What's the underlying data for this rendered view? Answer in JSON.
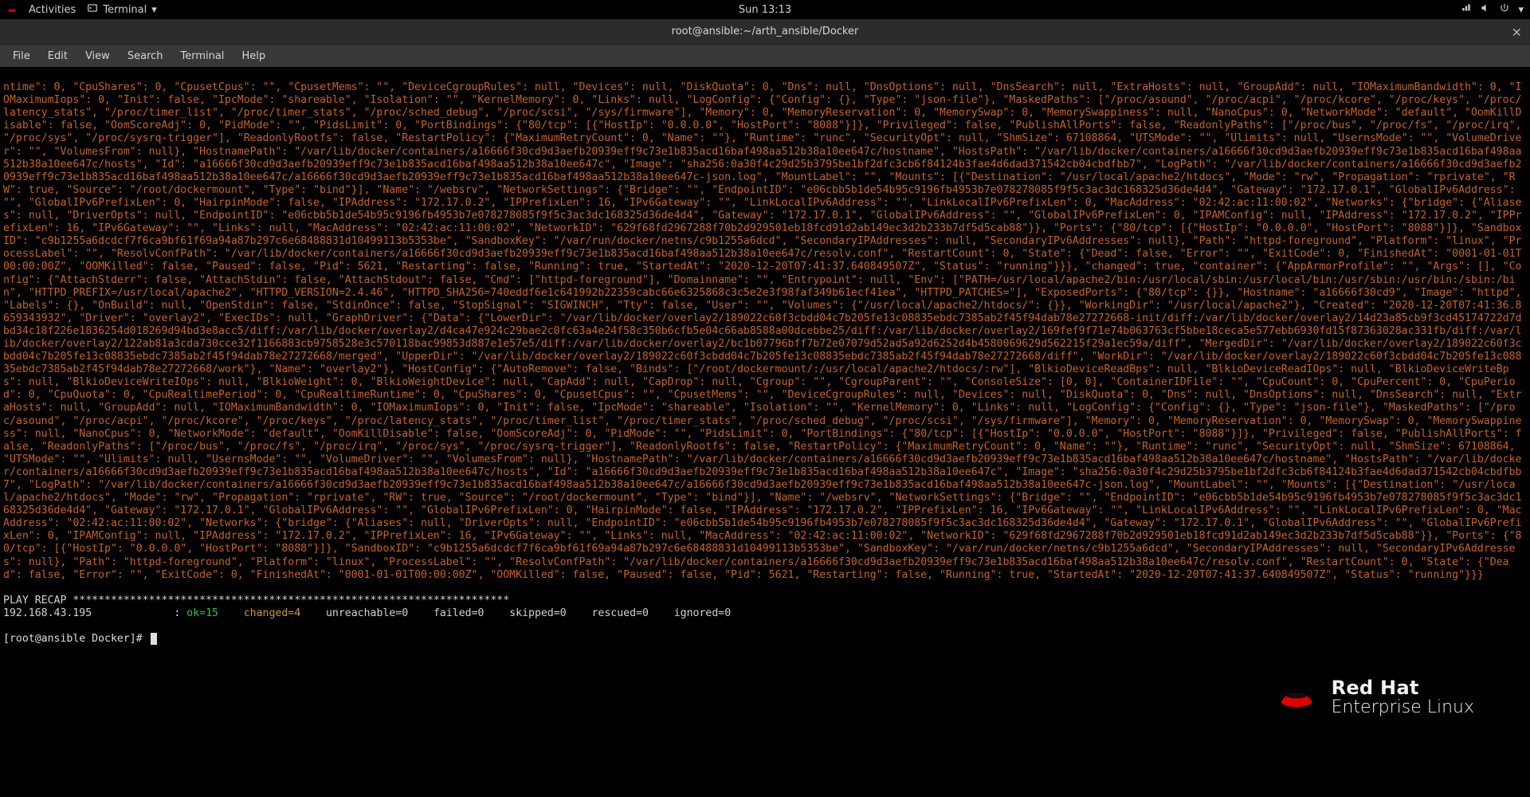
{
  "topbar": {
    "activities": "Activities",
    "app": "Terminal",
    "clock": "Sun 13:13"
  },
  "window": {
    "title": "root@ansible:~/arth_ansible/Docker"
  },
  "menu": {
    "items": [
      "File",
      "Edit",
      "View",
      "Search",
      "Terminal",
      "Help"
    ]
  },
  "docker_json": "ntime\": 0, \"CpuShares\": 0, \"CpusetCpus\": \"\", \"CpusetMems\": \"\", \"DeviceCgroupRules\": null, \"Devices\": null, \"DiskQuota\": 0, \"Dns\": null, \"DnsOptions\": null, \"DnsSearch\": null, \"ExtraHosts\": null, \"GroupAdd\": null, \"IOMaximumBandwidth\": 0, \"IOMaximumIops\": 0, \"Init\": false, \"IpcMode\": \"shareable\", \"Isolation\": \"\", \"KernelMemory\": 0, \"Links\": null, \"LogConfig\": {\"Config\": {}, \"Type\": \"json-file\"}, \"MaskedPaths\": [\"/proc/asound\", \"/proc/acpi\", \"/proc/kcore\", \"/proc/keys\", \"/proc/latency_stats\", \"/proc/timer_list\", \"/proc/timer_stats\", \"/proc/sched_debug\", \"/proc/scsi\", \"/sys/firmware\"], \"Memory\": 0, \"MemoryReservation\": 0, \"MemorySwap\": 0, \"MemorySwappiness\": null, \"NanoCpus\": 0, \"NetworkMode\": \"default\", \"OomKillDisable\": false, \"OomScoreAdj\": 0, \"PidMode\": \"\", \"PidsLimit\": 0, \"PortBindings\": {\"80/tcp\": [{\"HostIp\": \"0.0.0.0\", \"HostPort\": \"8088\"}]}, \"Privileged\": false, \"PublishAllPorts\": false, \"ReadonlyPaths\": [\"/proc/bus\", \"/proc/fs\", \"/proc/irq\", \"/proc/sys\", \"/proc/sysrq-trigger\"], \"ReadonlyRootfs\": false, \"RestartPolicy\": {\"MaximumRetryCount\": 0, \"Name\": \"\"}, \"Runtime\": \"runc\", \"SecurityOpt\": null, \"ShmSize\": 67108864, \"UTSMode\": \"\", \"Ulimits\": null, \"UsernsMode\": \"\", \"VolumeDriver\": \"\", \"VolumesFrom\": null}, \"HostnamePath\": \"/var/lib/docker/containers/a16666f30cd9d3aefb20939eff9c73e1b835acd16baf498aa512b38a10ee647c/hostname\", \"HostsPath\": \"/var/lib/docker/containers/a16666f30cd9d3aefb20939eff9c73e1b835acd16baf498aa512b38a10ee647c/hosts\", \"Id\": \"a16666f30cd9d3aefb20939eff9c73e1b835acd16baf498aa512b38a10ee647c\", \"Image\": \"sha256:0a30f4c29d25b3795be1bf2dfc3cb6f84124b3fae4d6dad371542cb04cbdfbb7\", \"LogPath\": \"/var/lib/docker/containers/a16666f30cd9d3aefb20939eff9c73e1b835acd16baf498aa512b38a10ee647c/a16666f30cd9d3aefb20939eff9c73e1b835acd16baf498aa512b38a10ee647c-json.log\", \"MountLabel\": \"\", \"Mounts\": [{\"Destination\": \"/usr/local/apache2/htdocs\", \"Mode\": \"rw\", \"Propagation\": \"rprivate\", \"RW\": true, \"Source\": \"/root/dockermount\", \"Type\": \"bind\"}], \"Name\": \"/websrv\", \"NetworkSettings\": {\"Bridge\": \"\", \"EndpointID\": \"e06cbb5b1de54b95c9196fb4953b7e078278085f9f5c3ac3dc168325d36de4d4\", \"Gateway\": \"172.17.0.1\", \"GlobalIPv6Address\": \"\", \"GlobalIPv6PrefixLen\": 0, \"HairpinMode\": false, \"IPAddress\": \"172.17.0.2\", \"IPPrefixLen\": 16, \"IPv6Gateway\": \"\", \"LinkLocalIPv6Address\": \"\", \"LinkLocalIPv6PrefixLen\": 0, \"MacAddress\": \"02:42:ac:11:00:02\", \"Networks\": {\"bridge\": {\"Aliases\": null, \"DriverOpts\": null, \"EndpointID\": \"e06cbb5b1de54b95c9196fb4953b7e078278085f9f5c3ac3dc168325d36de4d4\", \"Gateway\": \"172.17.0.1\", \"GlobalIPv6Address\": \"\", \"GlobalIPv6PrefixLen\": 0, \"IPAMConfig\": null, \"IPAddress\": \"172.17.0.2\", \"IPPrefixLen\": 16, \"IPv6Gateway\": \"\", \"Links\": null, \"MacAddress\": \"02:42:ac:11:00:02\", \"NetworkID\": \"629f68fd2967288f70b2d929501eb18fcd91d2ab149ec3d2b233b7df5d5cab88\"}}, \"Ports\": {\"80/tcp\": [{\"HostIp\": \"0.0.0.0\", \"HostPort\": \"8088\"}]}, \"SandboxID\": \"c9b1255a6dcdcf7f6ca9bf61f69a94a87b297c6e68488831d10499113b5353be\", \"SandboxKey\": \"/var/run/docker/netns/c9b1255a6dcd\", \"SecondaryIPAddresses\": null, \"SecondaryIPv6Addresses\": null}, \"Path\": \"httpd-foreground\", \"Platform\": \"linux\", \"ProcessLabel\": \"\", \"ResolvConfPath\": \"/var/lib/docker/containers/a16666f30cd9d3aefb20939eff9c73e1b835acd16baf498aa512b38a10ee647c/resolv.conf\", \"RestartCount\": 0, \"State\": {\"Dead\": false, \"Error\": \"\", \"ExitCode\": 0, \"FinishedAt\": \"0001-01-01T00:00:00Z\", \"OOMKilled\": false, \"Paused\": false, \"Pid\": 5621, \"Restarting\": false, \"Running\": true, \"StartedAt\": \"2020-12-20T07:41:37.640849507Z\", \"Status\": \"running\"}}}, \"changed\": true, \"container\": {\"AppArmorProfile\": \"\", \"Args\": [], \"Config\": {\"AttachStderr\": false, \"AttachStdin\": false, \"AttachStdout\": false, \"Cmd\": [\"httpd-foreground\"], \"Domainname\": \"\", \"Entrypoint\": null, \"Env\": [\"PATH=/usr/local/apache2/bin:/usr/local/sbin:/usr/local/bin:/usr/sbin:/usr/bin:/sbin:/bin\", \"HTTPD_PREFIX=/usr/local/apache2\", \"HTTPD_VERSION=2.4.46\", \"HTTPD_SHA256=740eddf6e1c641992b22359cabc66e6325868c3c5e2e3f98faf349b61ecf41ea\", \"HTTPD_PATCHES=\"], \"ExposedPorts\": {\"80/tcp\": {}}, \"Hostname\": \"a16666f30cd9\", \"Image\": \"httpd\", \"Labels\": {}, \"OnBuild\": null, \"OpenStdin\": false, \"StdinOnce\": false, \"StopSignal\": \"SIGWINCH\", \"Tty\": false, \"User\": \"\", \"Volumes\": {\"/usr/local/apache2/htdocs/\": {}}, \"WorkingDir\": \"/usr/local/apache2\"}, \"Created\": \"2020-12-20T07:41:36.8659343932\", \"Driver\": \"overlay2\", \"ExecIDs\": null, \"GraphDriver\": {\"Data\": {\"LowerDir\": \"/var/lib/docker/overlay2/189022c60f3cbdd04c7b205fe13c08835ebdc7385ab2f45f94dab78e27272668-init/diff:/var/lib/docker/overlay2/14d23a85cb9f3cd45174722d7dbd34c18f226e1836254d018269d94bd3e8acc5/diff:/var/lib/docker/overlay2/d4ca47e924c29bae2c0fc63a4e24f58c350b6cfb5e04c66ab8588a00dcebbe25/diff:/var/lib/docker/overlay2/169fef9f71e74b063763cf5bbe18ceca5e577ebb6930fd15f87363028ac331fb/diff:/var/lib/docker/overlay2/122ab81a3cda730cce32f1166883cb9758528e3c570118bac99853d887e1e57e5/diff:/var/lib/docker/overlay2/bc1b07796bff7b72e07079d52ad5a92d6252d4b4580069629d562215f29a1ec59a/diff\", \"MergedDir\": \"/var/lib/docker/overlay2/189022c60f3cbdd04c7b205fe13c08835ebdc7385ab2f45f94dab78e27272668/merged\", \"UpperDir\": \"/var/lib/docker/overlay2/189022c60f3cbdd04c7b205fe13c08835ebdc7385ab2f45f94dab78e27272668/diff\", \"WorkDir\": \"/var/lib/docker/overlay2/189022c60f3cbdd04c7b205fe13c08835ebdc7385ab2f45f94dab78e27272668/work\"}, \"Name\": \"overlay2\"}, \"HostConfig\": {\"AutoRemove\": false, \"Binds\": [\"/root/dockermount/:/usr/local/apache2/htdocs/:rw\"], \"BlkioDeviceReadBps\": null, \"BlkioDeviceReadIOps\": null, \"BlkioDeviceWriteBps\": null, \"BlkioDeviceWriteIOps\": null, \"BlkioWeight\": 0, \"BlkioWeightDevice\": null, \"CapAdd\": null, \"CapDrop\": null, \"Cgroup\": \"\", \"CgroupParent\": \"\", \"ConsoleSize\": [0, 0], \"ContainerIDFile\": \"\", \"CpuCount\": 0, \"CpuPercent\": 0, \"CpuPeriod\": 0, \"CpuQuota\": 0, \"CpuRealtimePeriod\": 0, \"CpuRealtimeRuntime\": 0, \"CpuShares\": 0, \"CpusetCpus\": \"\", \"CpusetMems\": \"\", \"DeviceCgroupRules\": null, \"Devices\": null, \"DiskQuota\": 0, \"Dns\": null, \"DnsOptions\": null, \"DnsSearch\": null, \"ExtraHosts\": null, \"GroupAdd\": null, \"IOMaximumBandwidth\": 0, \"IOMaximumIops\": 0, \"Init\": false, \"IpcMode\": \"shareable\", \"Isolation\": \"\", \"KernelMemory\": 0, \"Links\": null, \"LogConfig\": {\"Config\": {}, \"Type\": \"json-file\"}, \"MaskedPaths\": [\"/proc/asound\", \"/proc/acpi\", \"/proc/kcore\", \"/proc/keys\", \"/proc/latency_stats\", \"/proc/timer_list\", \"/proc/timer_stats\", \"/proc/sched_debug\", \"/proc/scsi\", \"/sys/firmware\"], \"Memory\": 0, \"MemoryReservation\": 0, \"MemorySwap\": 0, \"MemorySwappiness\": null, \"NanoCpus\": 0, \"NetworkMode\": \"default\", \"OomKillDisable\": false, \"OomScoreAdj\": 0, \"PidMode\": \"\", \"PidsLimit\": 0, \"PortBindings\": {\"80/tcp\": [{\"HostIp\": \"0.0.0.0\", \"HostPort\": \"8088\"}]}, \"Privileged\": false, \"PublishAllPorts\": false, \"ReadonlyPaths\": [\"/proc/bus\", \"/proc/fs\", \"/proc/irq\", \"/proc/sys\", \"/proc/sysrq-trigger\"], \"ReadonlyRootfs\": false, \"RestartPolicy\": {\"MaximumRetryCount\": 0, \"Name\": \"\"}, \"Runtime\": \"runc\", \"SecurityOpt\": null, \"ShmSize\": 67108864, \"UTSMode\": \"\", \"Ulimits\": null, \"UsernsMode\": \"\", \"VolumeDriver\": \"\", \"VolumesFrom\": null}, \"HostnamePath\": \"/var/lib/docker/containers/a16666f30cd9d3aefb20939eff9c73e1b835acd16baf498aa512b38a10ee647c/hostname\", \"HostsPath\": \"/var/lib/docker/containers/a16666f30cd9d3aefb20939eff9c73e1b835acd16baf498aa512b38a10ee647c/hosts\", \"Id\": \"a16666f30cd9d3aefb20939eff9c73e1b835acd16baf498aa512b38a10ee647c\", \"Image\": \"sha256:0a30f4c29d25b3795be1bf2dfc3cb6f84124b3fae4d6dad371542cb04cbdfbb7\", \"LogPath\": \"/var/lib/docker/containers/a16666f30cd9d3aefb20939eff9c73e1b835acd16baf498aa512b38a10ee647c/a16666f30cd9d3aefb20939eff9c73e1b835acd16baf498aa512b38a10ee647c-json.log\", \"MountLabel\": \"\", \"Mounts\": [{\"Destination\": \"/usr/local/apache2/htdocs\", \"Mode\": \"rw\", \"Propagation\": \"rprivate\", \"RW\": true, \"Source\": \"/root/dockermount\", \"Type\": \"bind\"}], \"Name\": \"/websrv\", \"NetworkSettings\": {\"Bridge\": \"\", \"EndpointID\": \"e06cbb5b1de54b95c9196fb4953b7e078278085f9f5c3ac3dc168325d36de4d4\", \"Gateway\": \"172.17.0.1\", \"GlobalIPv6Address\": \"\", \"GlobalIPv6PrefixLen\": 0, \"HairpinMode\": false, \"IPAddress\": \"172.17.0.2\", \"IPPrefixLen\": 16, \"IPv6Gateway\": \"\", \"LinkLocalIPv6Address\": \"\", \"LinkLocalIPv6PrefixLen\": 0, \"MacAddress\": \"02:42:ac:11:00:02\", \"Networks\": {\"bridge\": {\"Aliases\": null, \"DriverOpts\": null, \"EndpointID\": \"e06cbb5b1de54b95c9196fb4953b7e078278085f9f5c3ac3dc168325d36de4d4\", \"Gateway\": \"172.17.0.1\", \"GlobalIPv6Address\": \"\", \"GlobalIPv6PrefixLen\": 0, \"IPAMConfig\": null, \"IPAddress\": \"172.17.0.2\", \"IPPrefixLen\": 16, \"IPv6Gateway\": \"\", \"Links\": null, \"MacAddress\": \"02:42:ac:11:00:02\", \"NetworkID\": \"629f68fd2967288f70b2d929501eb18fcd91d2ab149ec3d2b233b7df5d5cab88\"}}, \"Ports\": {\"80/tcp\": [{\"HostIp\": \"0.0.0.0\", \"HostPort\": \"8088\"}]}, \"SandboxID\": \"c9b1255a6dcdcf7f6ca9bf61f69a94a87b297c6e68488831d10499113b5353be\", \"SandboxKey\": \"/var/run/docker/netns/c9b1255a6dcd\", \"SecondaryIPAddresses\": null, \"SecondaryIPv6Addresses\": null}, \"Path\": \"httpd-foreground\", \"Platform\": \"linux\", \"ProcessLabel\": \"\", \"ResolvConfPath\": \"/var/lib/docker/containers/a16666f30cd9d3aefb20939eff9c73e1b835acd16baf498aa512b38a10ee647c/resolv.conf\", \"RestartCount\": 0, \"State\": {\"Dead\": false, \"Error\": \"\", \"ExitCode\": 0, \"FinishedAt\": \"0001-01-01T00:00:00Z\", \"OOMKilled\": false, \"Paused\": false, \"Pid\": 5621, \"Restarting\": false, \"Running\": true, \"StartedAt\": \"2020-12-20T07:41:37.640849507Z\", \"Status\": \"running\"}}}",
  "recap_header": "PLAY RECAP *********************************************************************",
  "recap": {
    "host": "192.168.43.195",
    "ok": "ok=15",
    "changed": "changed=4",
    "unreachable": "unreachable=0",
    "failed": "failed=0",
    "skipped": "skipped=0",
    "rescued": "rescued=0",
    "ignored": "ignored=0"
  },
  "prompt": "[root@ansible Docker]# ",
  "watermark": {
    "l1": "Red Hat",
    "l2": "Enterprise Linux"
  }
}
